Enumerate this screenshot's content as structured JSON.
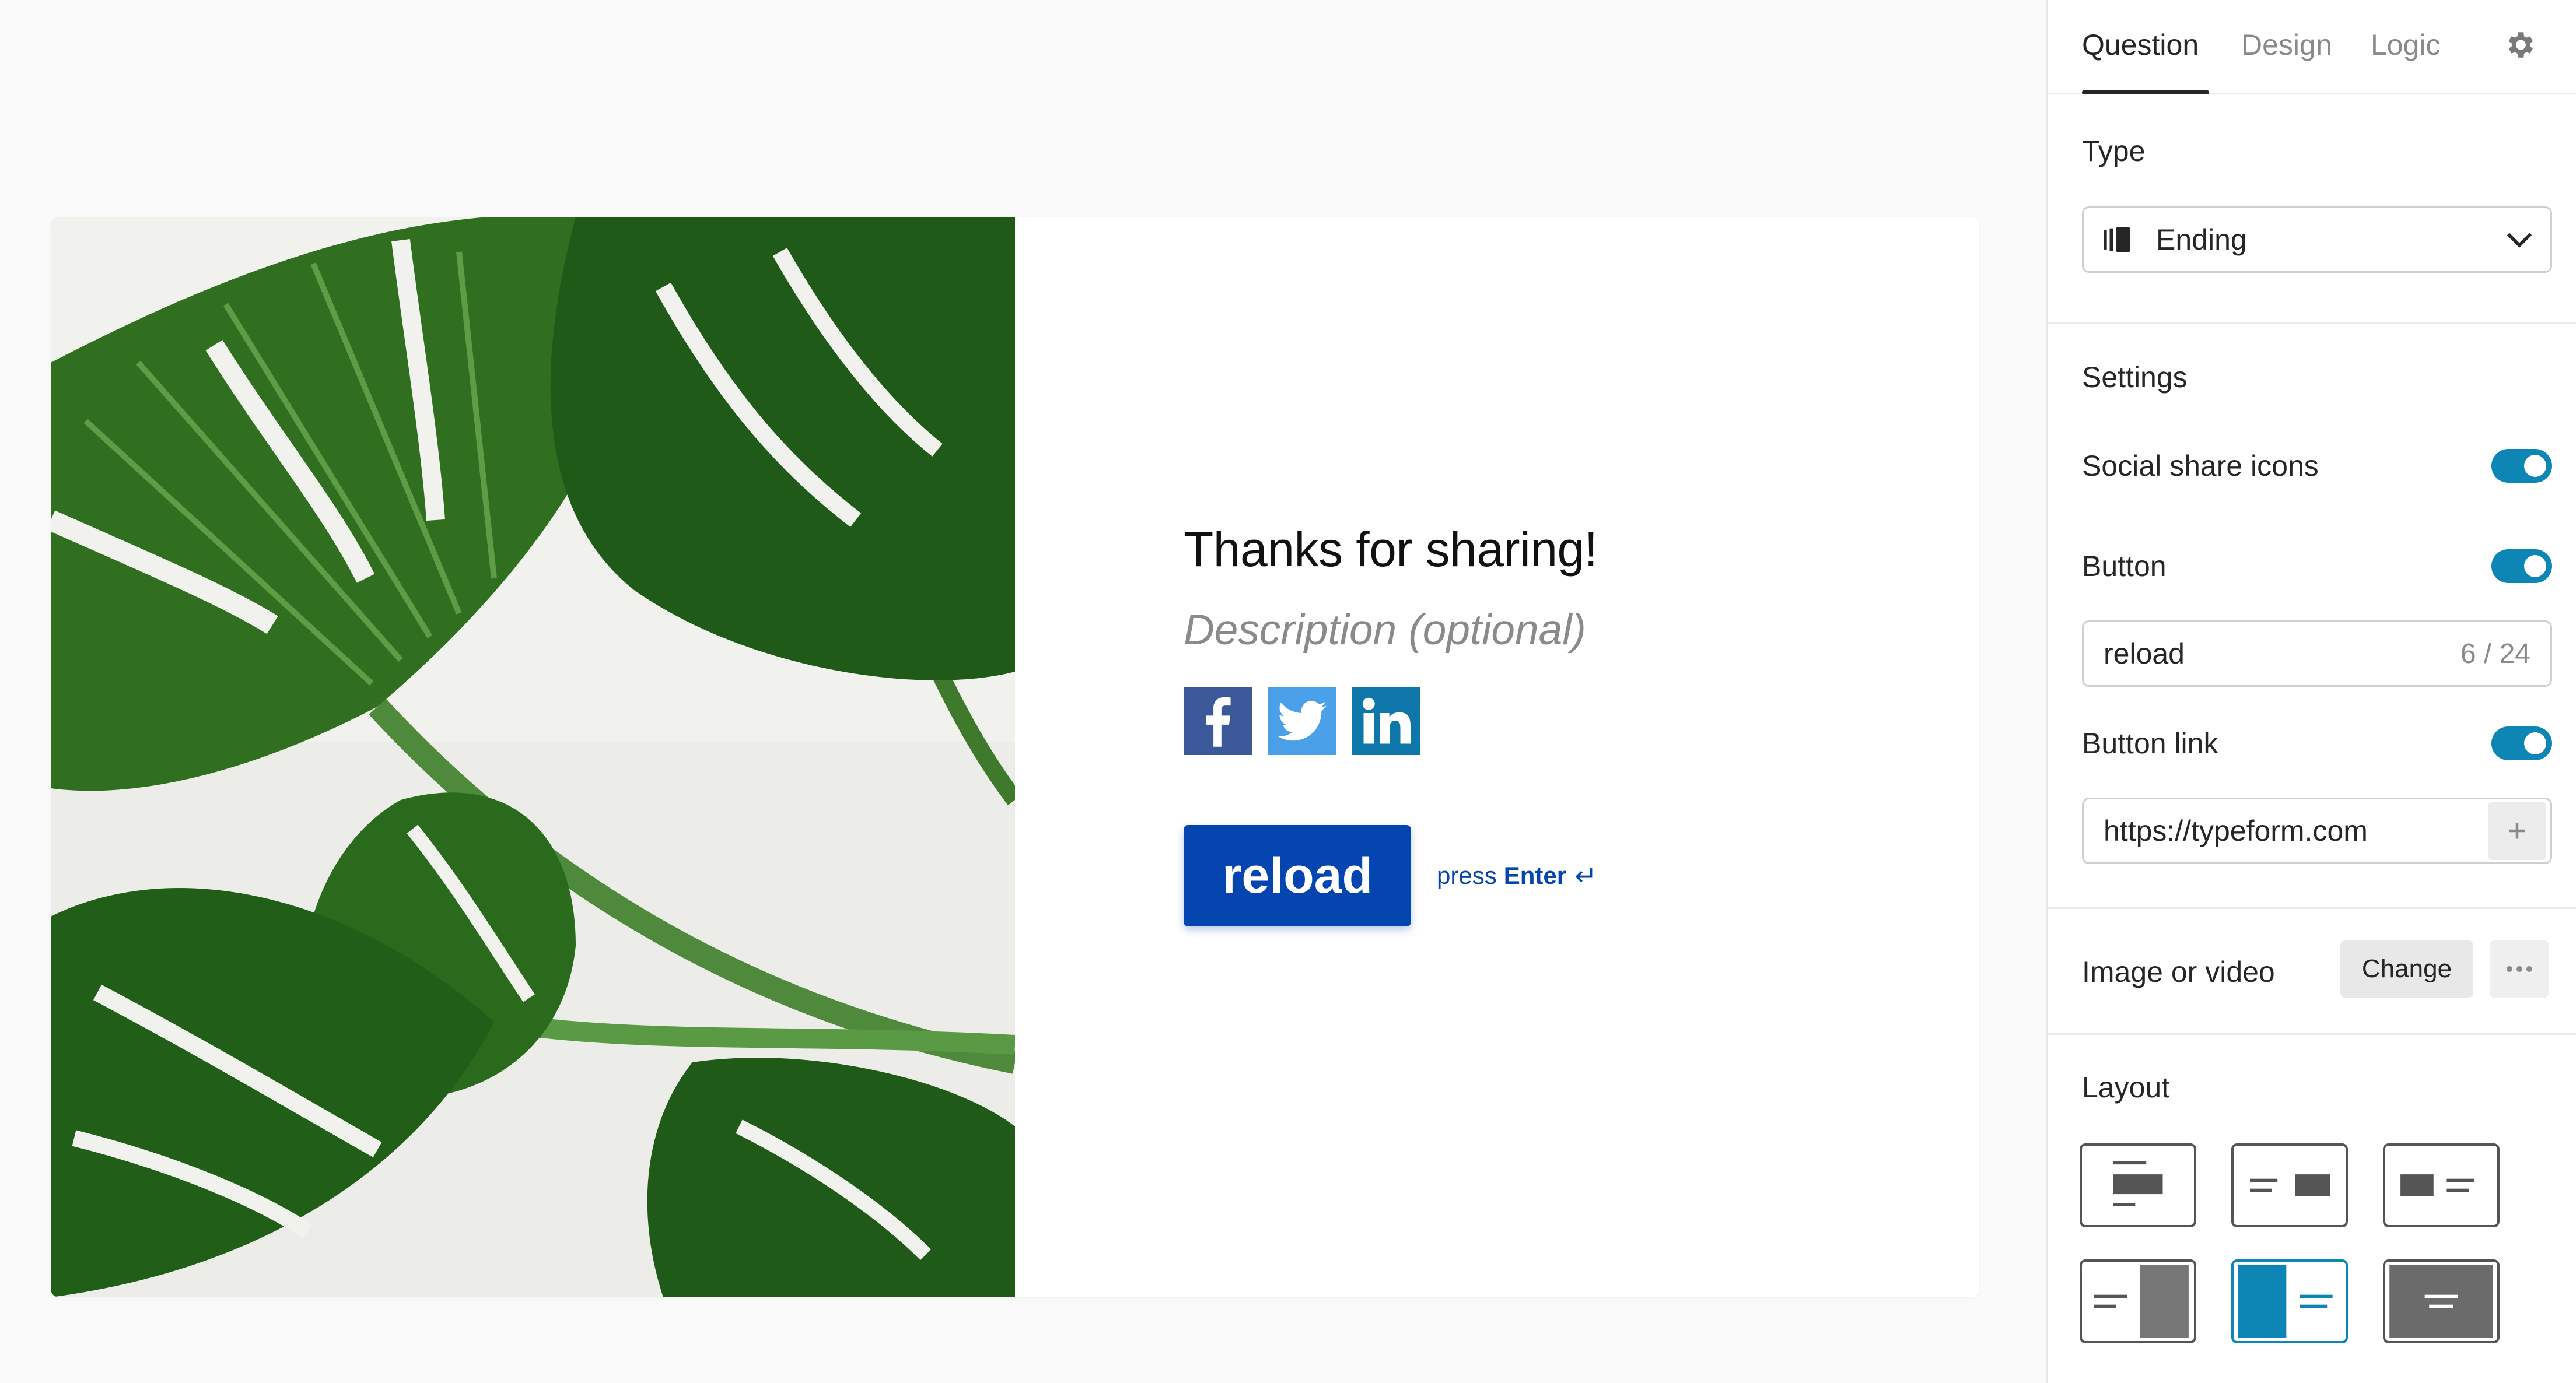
{
  "preview": {
    "title": "Thanks for sharing!",
    "description_placeholder": "Description (optional)",
    "social_icons": [
      "facebook-icon",
      "twitter-icon",
      "linkedin-icon"
    ],
    "button_label": "reload",
    "press_label": "press",
    "enter_label": "Enter",
    "enter_symbol": "↵",
    "accent_color": "#0445af"
  },
  "panel": {
    "tabs": [
      {
        "label": "Question",
        "active": true
      },
      {
        "label": "Design",
        "active": false
      },
      {
        "label": "Logic",
        "active": false
      }
    ],
    "type": {
      "label": "Type",
      "value": "Ending"
    },
    "settings": {
      "label": "Settings",
      "social_share_icons": {
        "label": "Social share icons",
        "on": true
      },
      "button": {
        "label": "Button",
        "on": true,
        "value": "reload",
        "count": "6 / 24"
      },
      "button_link": {
        "label": "Button link",
        "on": true,
        "value": "https://typeform.com"
      }
    },
    "image_or_video": {
      "label": "Image or video",
      "change_label": "Change"
    },
    "layout": {
      "label": "Layout",
      "options": [
        "image-top",
        "text-left-image-right",
        "image-left-text-right",
        "text-left-image-split",
        "image-split-left-text",
        "image-background"
      ],
      "selected": "image-split-left-text"
    },
    "toggle_color": "#0d86b6"
  }
}
